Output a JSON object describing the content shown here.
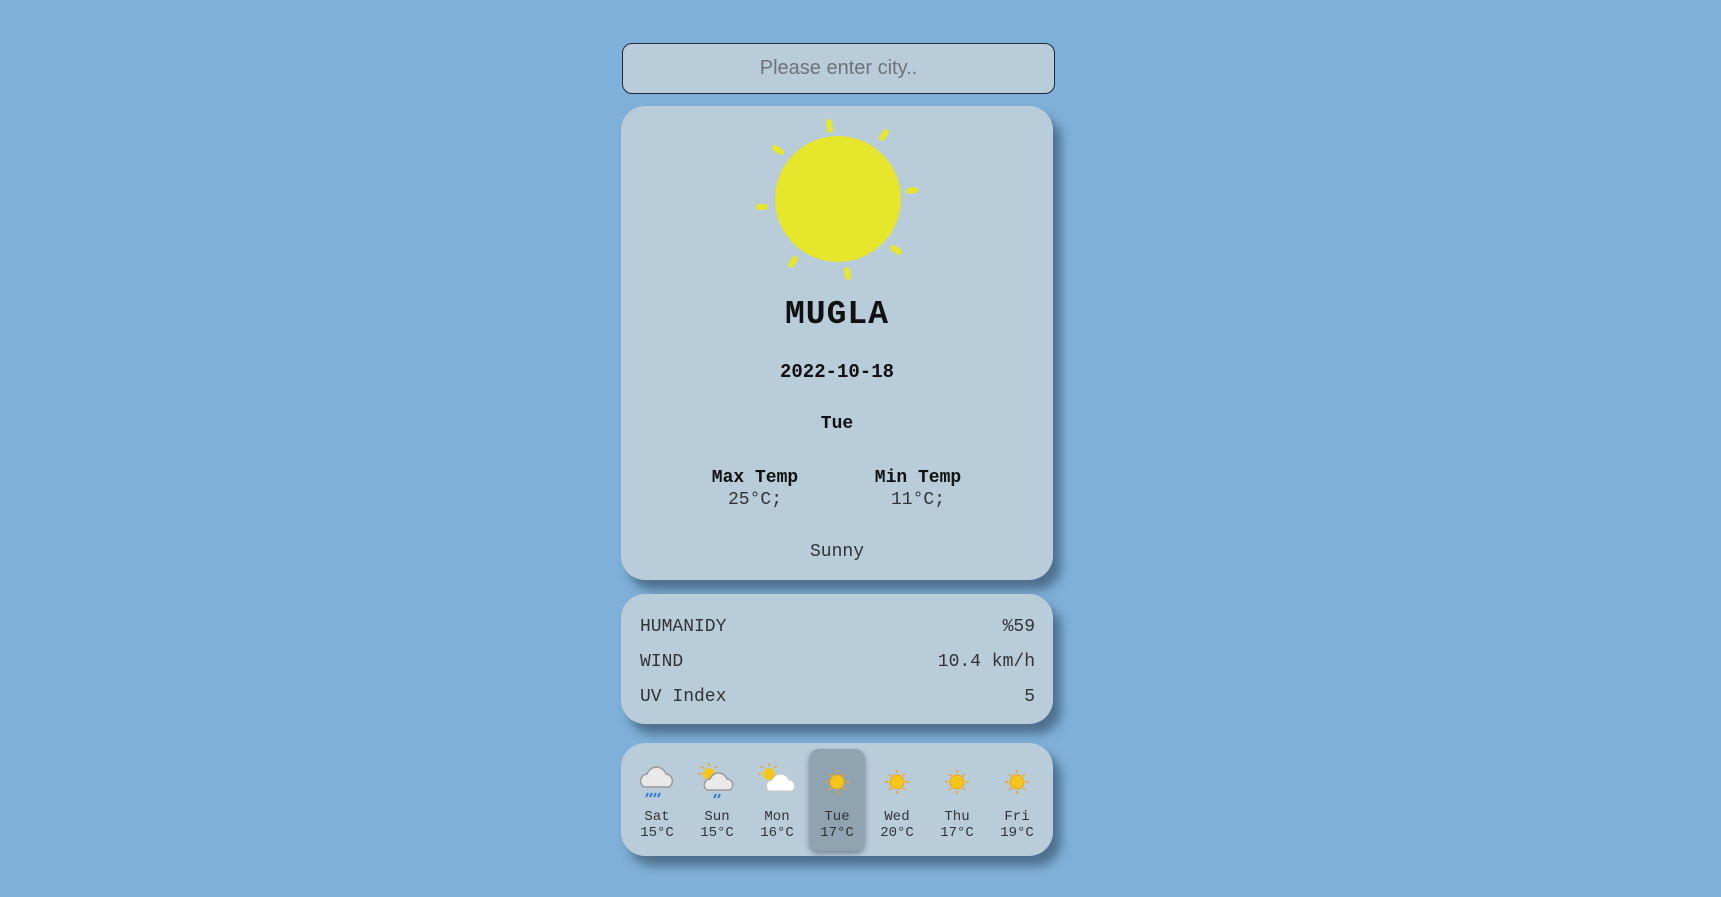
{
  "search": {
    "placeholder": "Please enter city..",
    "value": ""
  },
  "current": {
    "icon": "sun-icon",
    "city": "MUGLA",
    "date": "2022-10-18",
    "day": "Tue",
    "max_temp_label": "Max Temp",
    "max_temp": "25°C;",
    "min_temp_label": "Min Temp",
    "min_temp": "11°C;",
    "condition": "Sunny"
  },
  "details": [
    {
      "label": "HUMANIDY",
      "value": "%59"
    },
    {
      "label": "WIND",
      "value": "10.4 km/h"
    },
    {
      "label": "UV Index",
      "value": "5"
    }
  ],
  "forecast": [
    {
      "day": "Sat",
      "temp": "15°C",
      "icon": "rain-cloud-icon",
      "active": false
    },
    {
      "day": "Sun",
      "temp": "15°C",
      "icon": "sun-rain-cloud-icon",
      "active": false
    },
    {
      "day": "Mon",
      "temp": "16°C",
      "icon": "partly-cloudy-icon",
      "active": false
    },
    {
      "day": "Tue",
      "temp": "17°C",
      "icon": "sun-icon",
      "active": true
    },
    {
      "day": "Wed",
      "temp": "20°C",
      "icon": "sun-icon",
      "active": false
    },
    {
      "day": "Thu",
      "temp": "17°C",
      "icon": "sun-icon",
      "active": false
    },
    {
      "day": "Fri",
      "temp": "19°C",
      "icon": "sun-icon",
      "active": false
    }
  ],
  "colors": {
    "background": "#7fb0d9",
    "card": "#b9ccda",
    "sun": "#e6e62c",
    "active_day": "#8fa3b1"
  }
}
